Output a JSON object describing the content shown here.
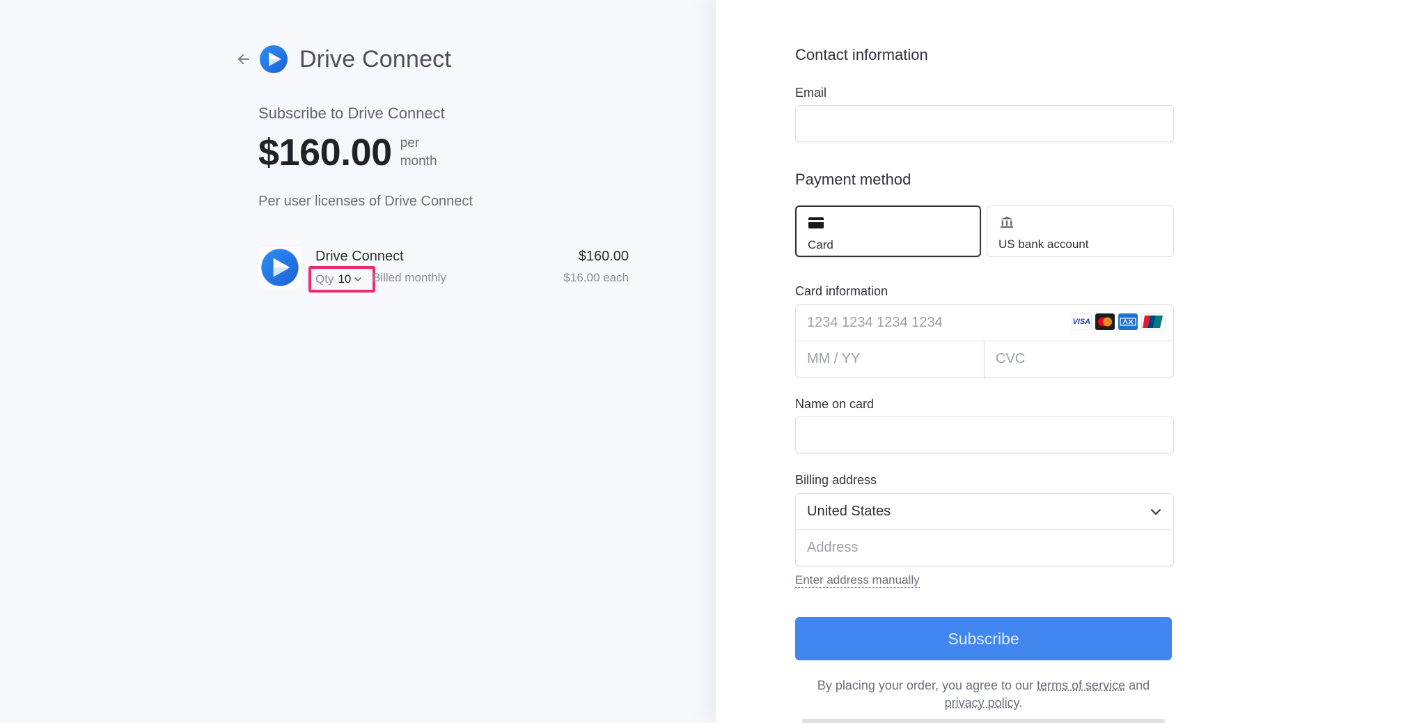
{
  "brand": {
    "name": "Drive Connect"
  },
  "summary": {
    "subscribe_to": "Subscribe to Drive Connect",
    "price": "$160.00",
    "period_line1": "per",
    "period_line2": "month",
    "description": "Per user licenses of Drive Connect"
  },
  "line_item": {
    "name": "Drive Connect",
    "qty_label": "Qty",
    "qty_value": "10",
    "billing": "Billed monthly",
    "total": "$160.00",
    "unit_price": "$16.00 each"
  },
  "contact": {
    "title": "Contact information",
    "email_label": "Email",
    "email_value": ""
  },
  "payment": {
    "title": "Payment method",
    "options": [
      {
        "label": "Card",
        "icon": "card-icon",
        "selected": true
      },
      {
        "label": "US bank account",
        "icon": "bank-icon",
        "selected": false
      }
    ],
    "card_info_label": "Card information",
    "card_number_placeholder": "1234 1234 1234 1234",
    "expiry_placeholder": "MM / YY",
    "cvc_placeholder": "CVC",
    "card_brands": [
      "VISA",
      "mastercard-icon",
      "amex-icon",
      "unionpay-icon"
    ],
    "name_label": "Name on card",
    "name_value": ""
  },
  "billing": {
    "title": "Billing address",
    "country": "United States",
    "address_placeholder": "Address",
    "manual_link": "Enter address manually"
  },
  "actions": {
    "subscribe_label": "Subscribe",
    "legal_prefix": "By placing your order, you agree to our ",
    "terms_link": "terms of service",
    "legal_and": " and ",
    "privacy_link": "privacy policy",
    "legal_suffix": "."
  },
  "colors": {
    "accent": "#4287f0",
    "highlight": "#ea2d6d",
    "left_bg": "#f6f8fb"
  }
}
